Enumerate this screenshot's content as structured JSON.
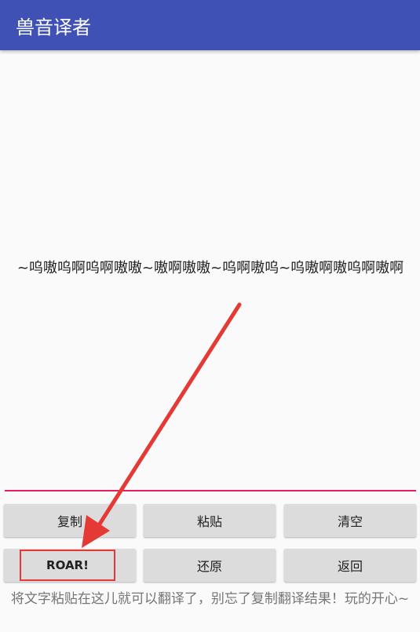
{
  "app_bar": {
    "title": "兽音译者"
  },
  "main": {
    "output_text": "~呜嗷呜啊呜啊嗷嗷~嗷啊嗷嗷~呜啊嗷呜~呜嗷啊嗷呜啊嗷啊",
    "buttons": {
      "copy": "复制",
      "paste": "粘贴",
      "clear": "清空",
      "roar": "ROAR!",
      "restore": "还原",
      "back": "返回"
    },
    "hint": "将文字粘贴在这儿就可以翻译了，别忘了复制翻译结果！玩的开心~"
  },
  "colors": {
    "primary": "#3f51b5",
    "accent": "#e91e63",
    "annotation": "#e53935"
  }
}
